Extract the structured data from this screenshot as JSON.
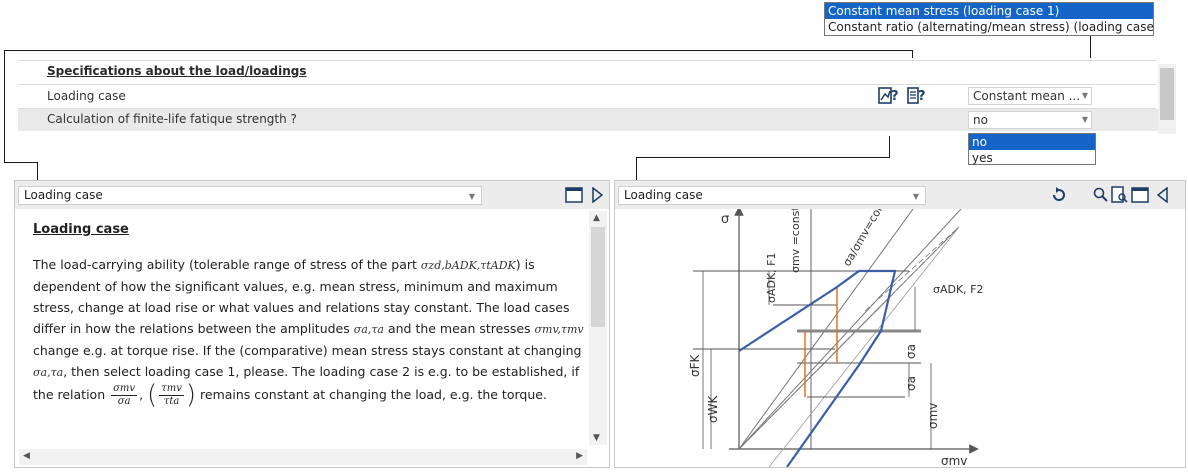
{
  "loading_case_list": {
    "options": [
      "Constant mean stress (loading case 1)",
      "Constant ratio (alternating/mean stress) (loading case 2)"
    ]
  },
  "spec": {
    "title": "Specifications about the load/loadings",
    "loading_case_label": "Loading case",
    "finite_label": "Calculation of finite-life fatique strength ?",
    "loading_case_value": "Constant mean ...",
    "finite_value": "no"
  },
  "yes_no_list": {
    "options": [
      "no",
      "yes"
    ]
  },
  "left_panel": {
    "select": "Loading case",
    "help_title": "Loading case",
    "p1": "The load-carrying ability (tolerable range of stress of the part",
    "sym1": "σzd,bADK,τtADK",
    "p2": ") is dependent of how the significant values, e.g. mean stress, minimum and maximum stress, change at load rise or what values and relations stay constant. The load cases differ in how the relations between the amplitudes",
    "sym2": "σa,τa",
    "p3": "and the mean stresses",
    "sym3": "σmv,τmv",
    "p4": "change e.g. at torque rise. If the (comparative) mean stress stays constant at changing",
    "sym4": "σa,τa",
    "p5": ", then select loading case 1, please. The loading case 2 is e.g. to be established, if the relation",
    "frac1_num": "σmv",
    "frac1_den": "σa",
    "comma": ",",
    "frac2_num": "τmv",
    "frac2_den": "τta",
    "p6": "remains constant at changing the load, e.g. the torque."
  },
  "right_panel": {
    "select": "Loading case",
    "labels": {
      "sigma": "σ",
      "sigma_mv_const": "σmv =const.(f",
      "sigma_ratio": "σa/σmv=const.(",
      "sigma_adk_f1": "σADK, F1",
      "sigma_adk_f2": "σADK, F2",
      "sigma_fk": "σFK",
      "sigma_wk": "σWK",
      "sigma_a1": "σa",
      "sigma_a2": "σa",
      "sigma_mv_v": "σmv",
      "sigma_mv_axis": "σmv"
    }
  },
  "colors": {
    "accent": "#1565c8",
    "curve": "#3a5fa8",
    "orange": "#e07030"
  }
}
